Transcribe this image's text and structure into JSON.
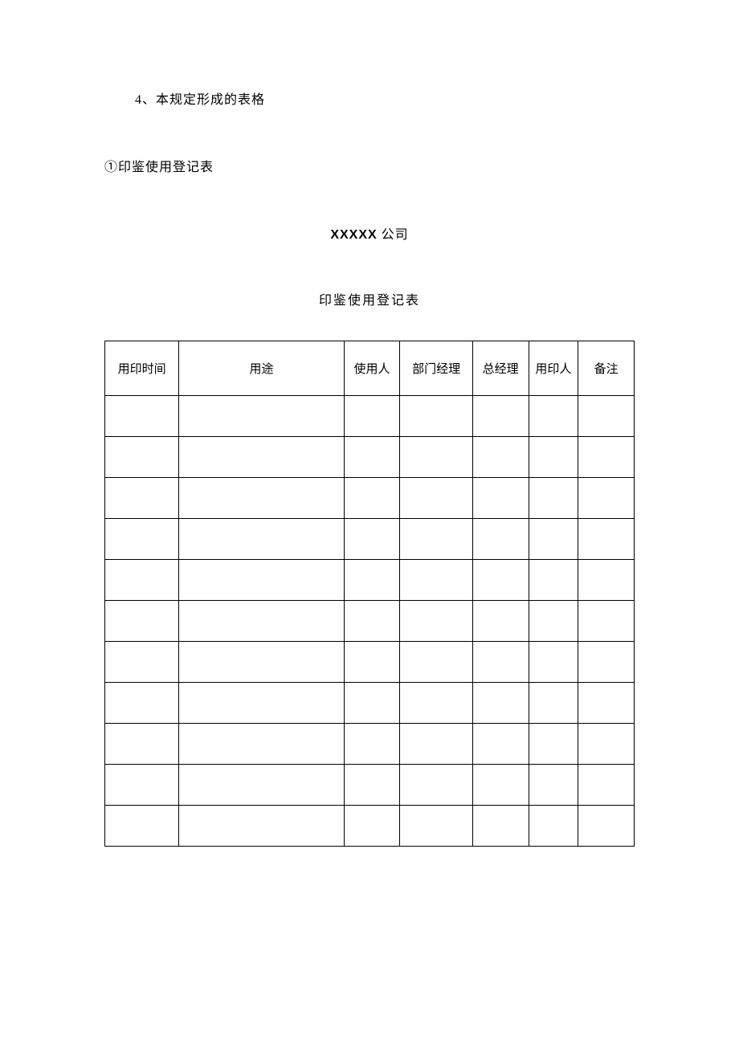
{
  "section": {
    "number_heading": "4、本规定形成的表格",
    "sub_heading": "①印鉴使用登记表"
  },
  "company": {
    "name_prefix": "XXXXX",
    "name_suffix": " 公司"
  },
  "table": {
    "title": "印鉴使用登记表",
    "headers": [
      "用印时间",
      "用途",
      "使用人",
      "部门经理",
      "总经理",
      "用印人",
      "备注"
    ],
    "row_count": 11
  }
}
